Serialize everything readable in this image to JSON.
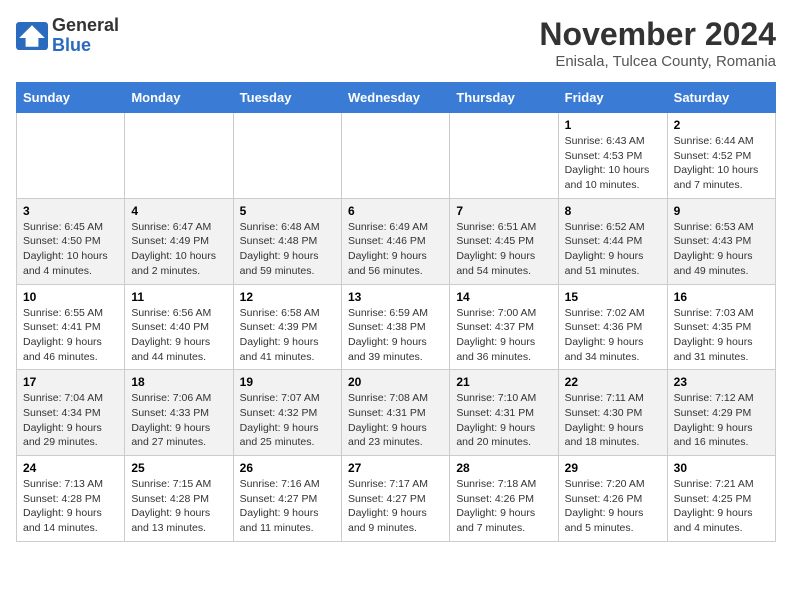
{
  "logo": {
    "general": "General",
    "blue": "Blue"
  },
  "title": "November 2024",
  "subtitle": "Enisala, Tulcea County, Romania",
  "headers": [
    "Sunday",
    "Monday",
    "Tuesday",
    "Wednesday",
    "Thursday",
    "Friday",
    "Saturday"
  ],
  "weeks": [
    [
      {
        "day": "",
        "info": ""
      },
      {
        "day": "",
        "info": ""
      },
      {
        "day": "",
        "info": ""
      },
      {
        "day": "",
        "info": ""
      },
      {
        "day": "",
        "info": ""
      },
      {
        "day": "1",
        "info": "Sunrise: 6:43 AM\nSunset: 4:53 PM\nDaylight: 10 hours and 10 minutes."
      },
      {
        "day": "2",
        "info": "Sunrise: 6:44 AM\nSunset: 4:52 PM\nDaylight: 10 hours and 7 minutes."
      }
    ],
    [
      {
        "day": "3",
        "info": "Sunrise: 6:45 AM\nSunset: 4:50 PM\nDaylight: 10 hours and 4 minutes."
      },
      {
        "day": "4",
        "info": "Sunrise: 6:47 AM\nSunset: 4:49 PM\nDaylight: 10 hours and 2 minutes."
      },
      {
        "day": "5",
        "info": "Sunrise: 6:48 AM\nSunset: 4:48 PM\nDaylight: 9 hours and 59 minutes."
      },
      {
        "day": "6",
        "info": "Sunrise: 6:49 AM\nSunset: 4:46 PM\nDaylight: 9 hours and 56 minutes."
      },
      {
        "day": "7",
        "info": "Sunrise: 6:51 AM\nSunset: 4:45 PM\nDaylight: 9 hours and 54 minutes."
      },
      {
        "day": "8",
        "info": "Sunrise: 6:52 AM\nSunset: 4:44 PM\nDaylight: 9 hours and 51 minutes."
      },
      {
        "day": "9",
        "info": "Sunrise: 6:53 AM\nSunset: 4:43 PM\nDaylight: 9 hours and 49 minutes."
      }
    ],
    [
      {
        "day": "10",
        "info": "Sunrise: 6:55 AM\nSunset: 4:41 PM\nDaylight: 9 hours and 46 minutes."
      },
      {
        "day": "11",
        "info": "Sunrise: 6:56 AM\nSunset: 4:40 PM\nDaylight: 9 hours and 44 minutes."
      },
      {
        "day": "12",
        "info": "Sunrise: 6:58 AM\nSunset: 4:39 PM\nDaylight: 9 hours and 41 minutes."
      },
      {
        "day": "13",
        "info": "Sunrise: 6:59 AM\nSunset: 4:38 PM\nDaylight: 9 hours and 39 minutes."
      },
      {
        "day": "14",
        "info": "Sunrise: 7:00 AM\nSunset: 4:37 PM\nDaylight: 9 hours and 36 minutes."
      },
      {
        "day": "15",
        "info": "Sunrise: 7:02 AM\nSunset: 4:36 PM\nDaylight: 9 hours and 34 minutes."
      },
      {
        "day": "16",
        "info": "Sunrise: 7:03 AM\nSunset: 4:35 PM\nDaylight: 9 hours and 31 minutes."
      }
    ],
    [
      {
        "day": "17",
        "info": "Sunrise: 7:04 AM\nSunset: 4:34 PM\nDaylight: 9 hours and 29 minutes."
      },
      {
        "day": "18",
        "info": "Sunrise: 7:06 AM\nSunset: 4:33 PM\nDaylight: 9 hours and 27 minutes."
      },
      {
        "day": "19",
        "info": "Sunrise: 7:07 AM\nSunset: 4:32 PM\nDaylight: 9 hours and 25 minutes."
      },
      {
        "day": "20",
        "info": "Sunrise: 7:08 AM\nSunset: 4:31 PM\nDaylight: 9 hours and 23 minutes."
      },
      {
        "day": "21",
        "info": "Sunrise: 7:10 AM\nSunset: 4:31 PM\nDaylight: 9 hours and 20 minutes."
      },
      {
        "day": "22",
        "info": "Sunrise: 7:11 AM\nSunset: 4:30 PM\nDaylight: 9 hours and 18 minutes."
      },
      {
        "day": "23",
        "info": "Sunrise: 7:12 AM\nSunset: 4:29 PM\nDaylight: 9 hours and 16 minutes."
      }
    ],
    [
      {
        "day": "24",
        "info": "Sunrise: 7:13 AM\nSunset: 4:28 PM\nDaylight: 9 hours and 14 minutes."
      },
      {
        "day": "25",
        "info": "Sunrise: 7:15 AM\nSunset: 4:28 PM\nDaylight: 9 hours and 13 minutes."
      },
      {
        "day": "26",
        "info": "Sunrise: 7:16 AM\nSunset: 4:27 PM\nDaylight: 9 hours and 11 minutes."
      },
      {
        "day": "27",
        "info": "Sunrise: 7:17 AM\nSunset: 4:27 PM\nDaylight: 9 hours and 9 minutes."
      },
      {
        "day": "28",
        "info": "Sunrise: 7:18 AM\nSunset: 4:26 PM\nDaylight: 9 hours and 7 minutes."
      },
      {
        "day": "29",
        "info": "Sunrise: 7:20 AM\nSunset: 4:26 PM\nDaylight: 9 hours and 5 minutes."
      },
      {
        "day": "30",
        "info": "Sunrise: 7:21 AM\nSunset: 4:25 PM\nDaylight: 9 hours and 4 minutes."
      }
    ]
  ]
}
